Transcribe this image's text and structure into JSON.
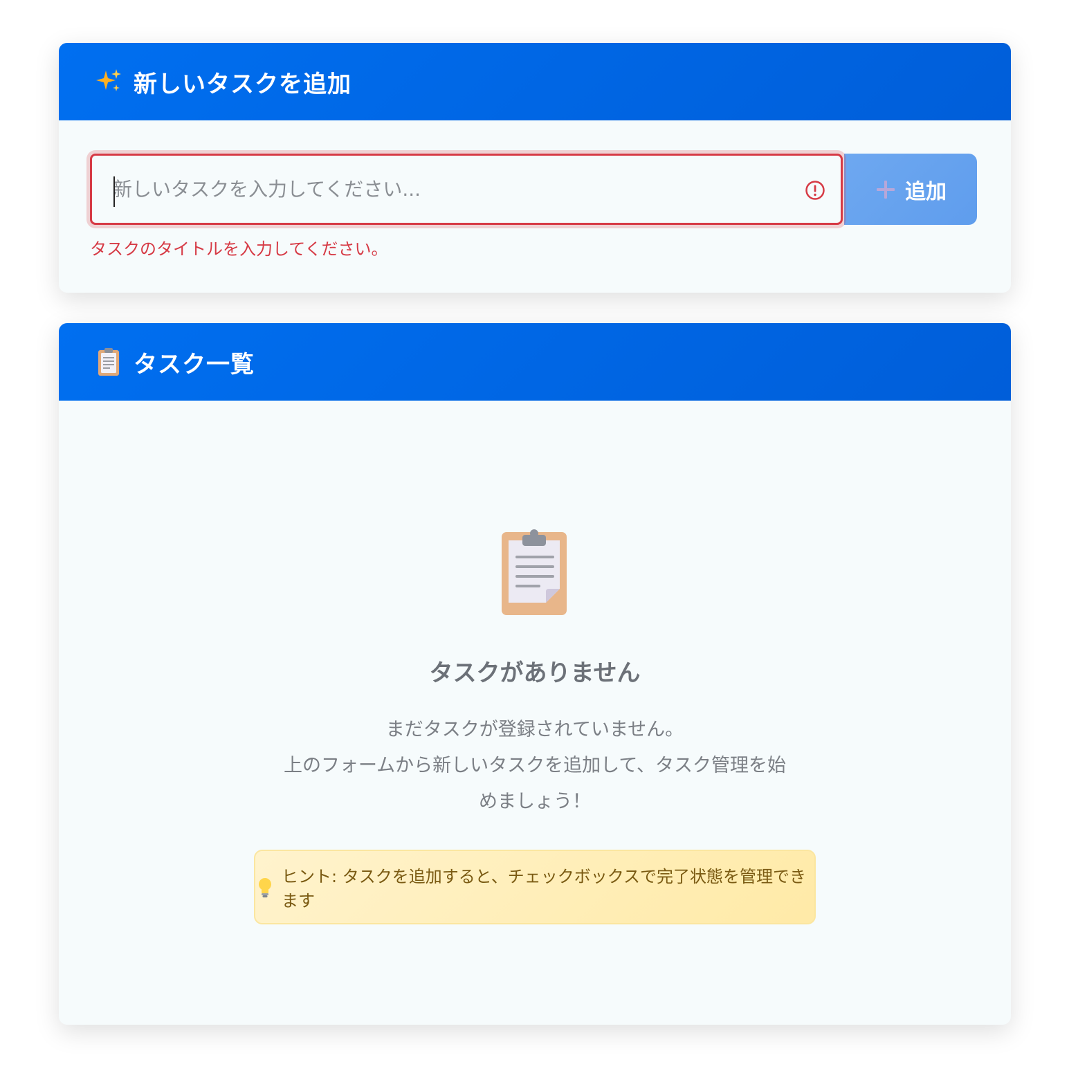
{
  "add_card": {
    "icon": "sparkles-icon",
    "title": "新しいタスクを追加",
    "input_placeholder": "新しいタスクを入力してください...",
    "input_value": "",
    "add_button_label": "追加",
    "error_message": "タスクのタイトルを入力してください。"
  },
  "list_card": {
    "icon": "clipboard-icon",
    "title": "タスク一覧",
    "empty_state": {
      "icon": "clipboard-icon",
      "title": "タスクがありません",
      "description_line1": "まだタスクが登録されていません。",
      "description_line2": "上のフォームから新しいタスクを追加して、タスク管理を始めましょう！",
      "hint": "ヒント: タスクを追加すると、チェックボックスで完了状態を管理できます"
    }
  },
  "colors": {
    "header_blue": "#006ff0",
    "error_red": "#d63a45",
    "button_blue": "#6ea8f0",
    "hint_yellow": "#fff3cd"
  }
}
